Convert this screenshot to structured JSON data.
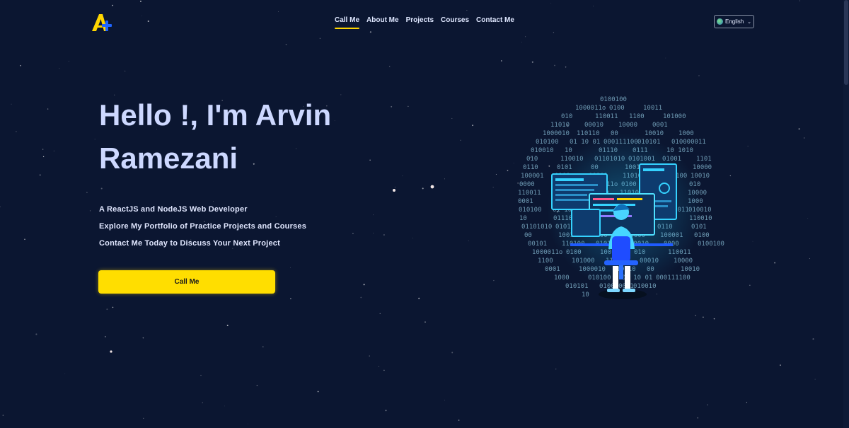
{
  "brand": {
    "logo_icon": "a-plus-logo-icon",
    "primary_color": "#ffd600",
    "secondary_color": "#1e64ff"
  },
  "nav": {
    "items": [
      {
        "label": "Call Me",
        "active": true
      },
      {
        "label": "About Me",
        "active": false
      },
      {
        "label": "Projects",
        "active": false
      },
      {
        "label": "Courses",
        "active": false
      },
      {
        "label": "Contact Me",
        "active": false
      }
    ]
  },
  "language": {
    "selected": "English",
    "icon": "globe-icon"
  },
  "hero": {
    "title": "Hello !, I'm Arvin Ramezani",
    "lines": [
      "A ReactJS and NodeJS Web Developer",
      "Explore My Portfolio of Practice Projects and Courses",
      "Contact Me Today to Discuss Your Next Project"
    ],
    "cta_label": "Call Me"
  },
  "illustration": {
    "icon": "developer-at-computer-illustration",
    "binary_text": [
      "0100100",
      "1000011o",
      "0100",
      "10011",
      "010",
      "110011",
      "1100",
      "101000",
      "11010",
      "00010",
      "10000",
      "0001",
      "1000010",
      "110110",
      "00",
      "10010",
      "1000",
      "010100",
      "01 10 01",
      "000111100",
      "010101",
      "010000011",
      "010010",
      "10",
      "01110",
      "0111",
      "10 1010",
      "010",
      "110010",
      "01101010",
      "0101001",
      "01001",
      "1101",
      "0110",
      "0101",
      "00",
      "100100",
      "1000",
      "10000",
      "100001",
      "0100",
      "00101",
      "110100",
      "01010100",
      "10010",
      "0000"
    ]
  }
}
